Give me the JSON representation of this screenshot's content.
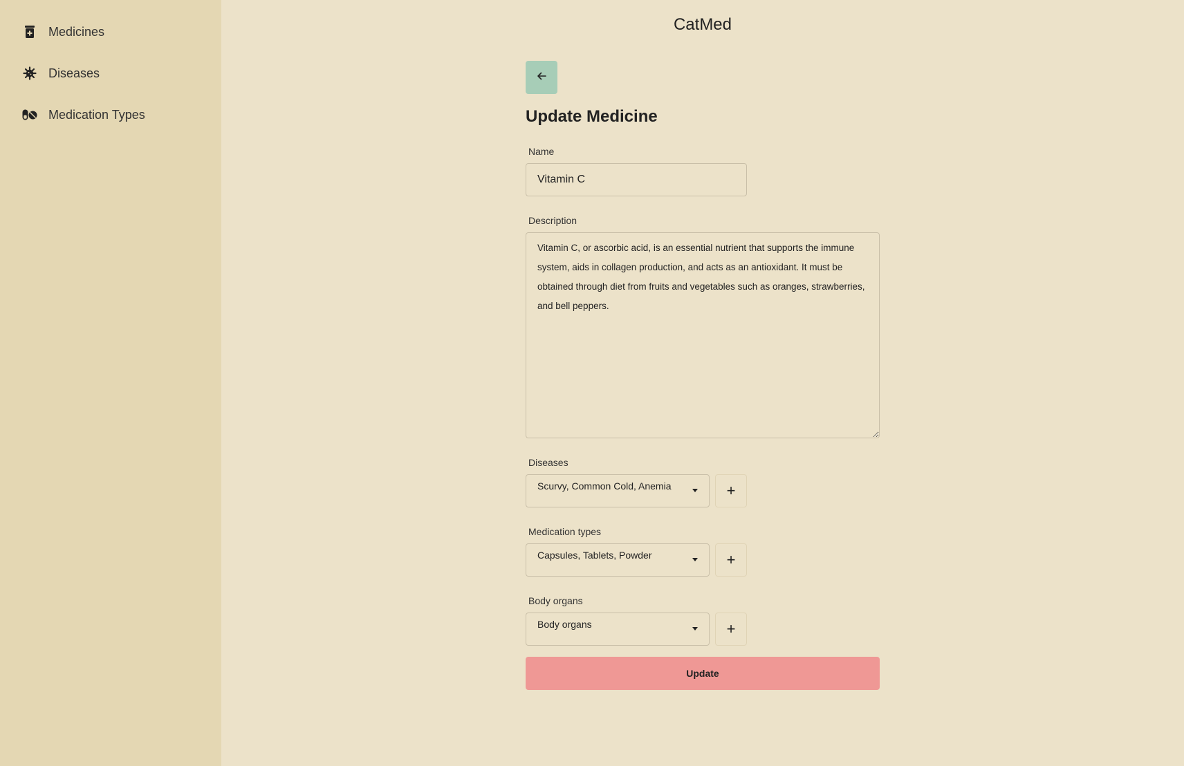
{
  "sidebar": {
    "items": [
      {
        "label": "Medicines",
        "icon": "medicine-bottle-icon"
      },
      {
        "label": "Diseases",
        "icon": "virus-icon"
      },
      {
        "label": "Medication Types",
        "icon": "pills-icon"
      }
    ]
  },
  "header": {
    "app_title": "CatMed"
  },
  "form": {
    "title": "Update Medicine",
    "back_icon": "arrow-left-icon",
    "name": {
      "label": "Name",
      "value": "Vitamin C"
    },
    "description": {
      "label": "Description",
      "value": "Vitamin C, or ascorbic acid, is an essential nutrient that supports the immune system, aids in collagen production, and acts as an antioxidant. It must be obtained through diet from fruits and vegetables such as oranges, strawberries, and bell peppers."
    },
    "diseases": {
      "label": "Diseases",
      "value": "Scurvy, Common Cold, Anemia",
      "add_label": "+"
    },
    "medication_types": {
      "label": "Medication types",
      "value": "Capsules, Tablets, Powder",
      "add_label": "+"
    },
    "body_organs": {
      "label": "Body organs",
      "value": "Body organs",
      "add_label": "+"
    },
    "submit_label": "Update"
  },
  "colors": {
    "sidebar_bg": "#e4d7b3",
    "page_bg": "#ece2c9",
    "back_button": "#a7cdb7",
    "update_button": "#ef9895"
  }
}
